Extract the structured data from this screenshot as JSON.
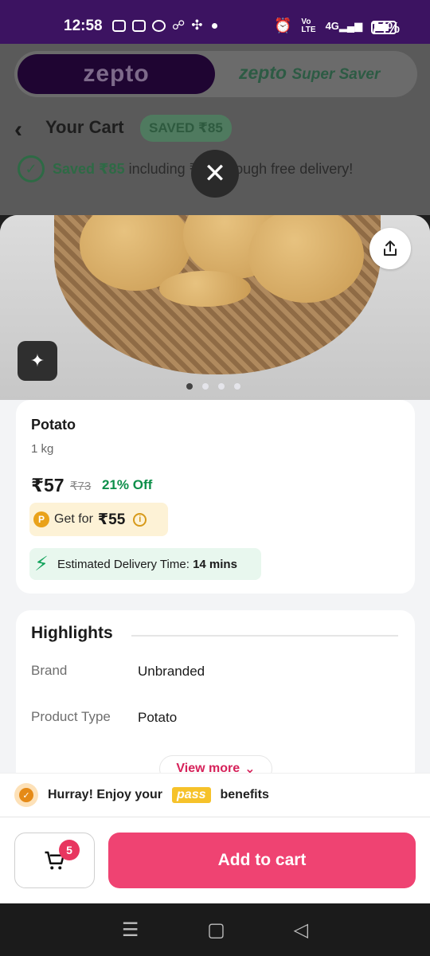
{
  "status_bar": {
    "time": "12:58",
    "battery_percent": "74%",
    "battery_level": 0.74,
    "icons": [
      "message-icon",
      "chat-icon",
      "bubble-icon",
      "missed-call-icon",
      "teams-icon",
      "dot-icon",
      "alarm-icon",
      "volte-icon",
      "signal-4g-icon",
      "battery-icon"
    ]
  },
  "background_app": {
    "brand_tab": "zepto",
    "saver_tab_brand": "zepto",
    "saver_tab_label": "Super Saver",
    "cart_title": "Your Cart",
    "saved_badge": "SAVED ₹85",
    "saved_line_bold": "Saved ₹85",
    "saved_line_rest": " including ₹37 through free delivery!"
  },
  "product": {
    "name": "Potato",
    "quantity": "1 kg",
    "price": "₹57",
    "mrp": "₹73",
    "discount": "21% Off",
    "pass_label": "Get for",
    "pass_price": "₹55",
    "delivery_label": "Estimated Delivery Time:",
    "delivery_time": "14 mins",
    "image_count": 4,
    "active_image_index": 0
  },
  "highlights": {
    "title": "Highlights",
    "rows": [
      {
        "label": "Brand",
        "value": "Unbranded"
      },
      {
        "label": "Product Type",
        "value": "Potato"
      }
    ],
    "view_more": "View more"
  },
  "pass_banner": {
    "prefix": "Hurray! Enjoy your",
    "pass_word": "pass",
    "suffix": "benefits"
  },
  "cart": {
    "item_count": "5",
    "add_button": "Add to cart"
  },
  "colors": {
    "status_bar": "#3c1361",
    "accent_pink": "#ef4372",
    "discount_green": "#0d8f4a",
    "pass_gold": "#e9a21a"
  }
}
